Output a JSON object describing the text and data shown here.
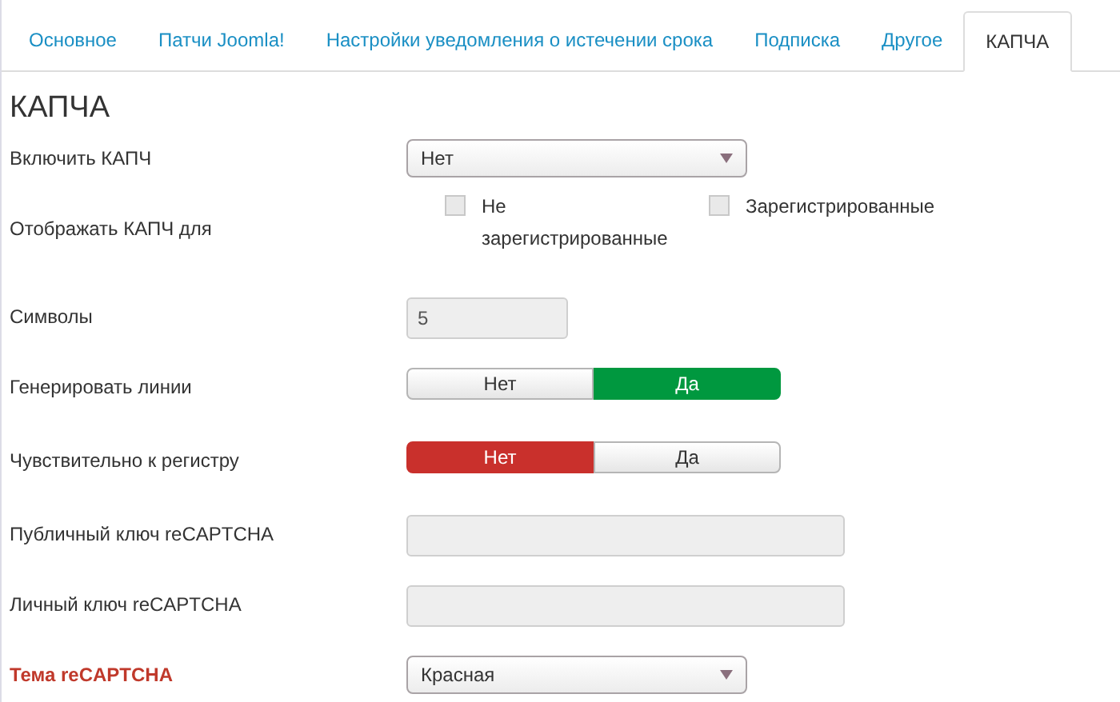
{
  "tabs": [
    {
      "label": "Основное",
      "selected": false
    },
    {
      "label": "Патчи Joomla!",
      "selected": false
    },
    {
      "label": "Настройки уведомления о истечении срока",
      "selected": false
    },
    {
      "label": "Подписка",
      "selected": false
    },
    {
      "label": "Другое",
      "selected": false
    },
    {
      "label": "КАПЧА",
      "selected": true
    }
  ],
  "heading": "КАПЧА",
  "fields": [
    {
      "kind": "select",
      "label": "Включить КАПЧ",
      "highlighted": false,
      "value": "Нет"
    },
    {
      "kind": "checkboxes",
      "label": "Отображать КАПЧ для",
      "highlighted": false,
      "options": [
        {
          "label": "Не зарегистрированные",
          "checked": false
        },
        {
          "label": "Зарегистрированные",
          "checked": false
        }
      ]
    },
    {
      "kind": "number",
      "label": "Символы",
      "highlighted": false,
      "value": "5"
    },
    {
      "kind": "toggle",
      "label": "Генерировать линии",
      "highlighted": false,
      "options": [
        {
          "label": "Нет",
          "selected": false
        },
        {
          "label": "Да",
          "selected": true
        }
      ]
    },
    {
      "kind": "toggle",
      "label": "Чувствительно к регистру",
      "highlighted": false,
      "options": [
        {
          "label": "Нет",
          "selected": true
        },
        {
          "label": "Да",
          "selected": false
        }
      ]
    },
    {
      "kind": "text",
      "label": "Публичный ключ reCAPTCHA",
      "highlighted": false
    },
    {
      "kind": "text",
      "label": "Личный ключ reCAPTCHA",
      "highlighted": false
    },
    {
      "kind": "select",
      "label": "Тема reCAPTCHA",
      "highlighted": true,
      "value": "Красная"
    }
  ]
}
